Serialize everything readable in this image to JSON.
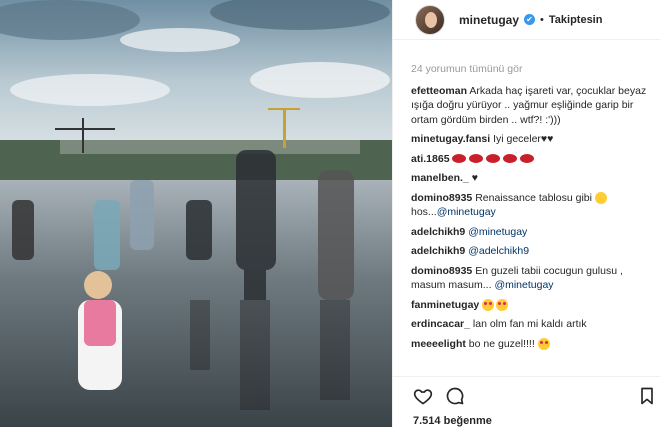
{
  "header": {
    "username": "minetugay",
    "verified_glyph": "✔",
    "separator": "•",
    "follow_status": "Takiptesin"
  },
  "comments_header": {
    "view_all": "24 yorumun tümünü gör"
  },
  "comments": [
    {
      "user": "efetteoman",
      "text": "Arkada haç işareti var, çocuklar beyaz ışığa doğru yürüyor .. yağmur eşliğinde garip bir ortam gördüm birden .. wtf?! :')))"
    },
    {
      "user": "minetugay.fansi",
      "text": "Iyi geceler♥♥"
    },
    {
      "user": "ati.1865",
      "text": ""
    },
    {
      "user": "manelben._",
      "text": "♥"
    },
    {
      "user": "domino8935",
      "text": "Renaissance tablosu gibi",
      "text2": "hos...",
      "mention": "@minetugay"
    },
    {
      "user": "adelchikh9",
      "text": "",
      "mention": "@minetugay"
    },
    {
      "user": "adelchikh9",
      "text": "",
      "mention": "@adelchikh9"
    },
    {
      "user": "domino8935",
      "text": "En guzeli tabii cocugun gulusu , masum masum...",
      "mention": "@minetugay"
    },
    {
      "user": "fanminetugay",
      "text": ""
    },
    {
      "user": "erdincacar_",
      "text": "lan olm fan mi kaldı artık"
    },
    {
      "user": "meeeelight",
      "text": "bo ne guzel!!!!"
    }
  ],
  "actions": {
    "like_icon": "heart-icon",
    "comment_icon": "comment-icon",
    "save_icon": "bookmark-icon"
  },
  "likes": {
    "count": "7.514",
    "label": "beğenme"
  },
  "colors": {
    "link": "#003569",
    "verified": "#3897f0",
    "muted": "#999999"
  }
}
